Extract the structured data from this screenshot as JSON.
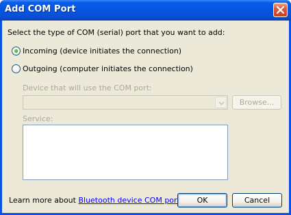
{
  "window": {
    "title": "Add COM Port",
    "close_icon": "close-icon"
  },
  "instruction": "Select the type of COM (serial) port that you want to add:",
  "port_types": [
    {
      "label": "Incoming (device initiates the connection)",
      "selected": true
    },
    {
      "label": "Outgoing (computer initiates the connection)",
      "selected": false
    }
  ],
  "device": {
    "label": "Device that will use the COM port:",
    "value": "",
    "browse_label": "Browse..."
  },
  "service": {
    "label": "Service:",
    "value": ""
  },
  "footer": {
    "learn_more_prefix": "Learn more about ",
    "link_text": "Bluetooth device COM ports",
    "learn_more_suffix": ".",
    "ok_label": "OK",
    "cancel_label": "Cancel"
  },
  "colors": {
    "titlebar": "#0556e2",
    "dialog_bg": "#ece9d8",
    "close_button": "#e35a3a",
    "link": "#0000ff",
    "disabled_text": "#aca899"
  }
}
